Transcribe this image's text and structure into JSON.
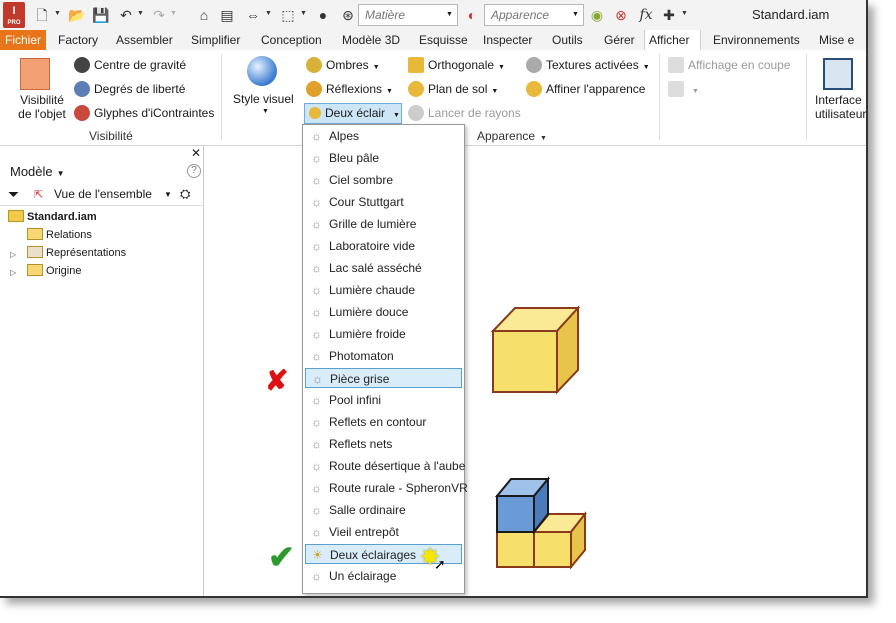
{
  "window": {
    "title": "Standard.iam"
  },
  "qat": {
    "logo_text": "I",
    "logo_sub": "PRO",
    "material_combo": "Matière",
    "appearance_combo": "Apparence",
    "fx_label": "fx"
  },
  "tabs": [
    {
      "label": "Fichier"
    },
    {
      "label": "Factory"
    },
    {
      "label": "Assembler"
    },
    {
      "label": "Simplifier"
    },
    {
      "label": "Conception"
    },
    {
      "label": "Modèle 3D"
    },
    {
      "label": "Esquisse"
    },
    {
      "label": "Inspecter"
    },
    {
      "label": "Outils"
    },
    {
      "label": "Gérer"
    },
    {
      "label": "Afficher"
    },
    {
      "label": "Environnements"
    },
    {
      "label": "Mise e"
    }
  ],
  "ribbon": {
    "visibilite_objet": "Visibilité de l'objet",
    "centre_gravite": "Centre de gravité",
    "degres_liberte": "Degrés de liberté",
    "glyphes": "Glyphes d'iContraintes",
    "panel_visibilite": "Visibilité",
    "style_visuel": "Style visuel",
    "ombres": "Ombres",
    "reflexions": "Réflexions",
    "deux_eclair": "Deux éclair",
    "orthogonale": "Orthogonale",
    "plan_de_sol": "Plan de sol",
    "lancer_rayons": "Lancer de rayons",
    "textures_activees": "Textures activées",
    "affiner_apparence": "Affiner l'apparence",
    "affichage_coupe": "Affichage en coupe",
    "panel_apparence": "Apparence",
    "interface": "Interface",
    "utilisateur": "utilisateur"
  },
  "browser": {
    "title": "Modèle",
    "view_label": "Vue de l'ensemble",
    "tree": [
      {
        "label": "Standard.iam"
      },
      {
        "label": "Relations"
      },
      {
        "label": "Représentations"
      },
      {
        "label": "Origine"
      }
    ]
  },
  "lighting_menu": {
    "items": [
      "Alpes",
      "Bleu pâle",
      "Ciel sombre",
      "Cour Stuttgart",
      "Grille de lumière",
      "Laboratoire vide",
      "Lac salé asséché",
      "Lumière chaude",
      "Lumière douce",
      "Lumière froide",
      "Photomaton",
      "Pièce grise",
      "Pool infini",
      "Reflets en contour",
      "Reflets nets",
      "Route désertique à l'aube",
      "Route rurale - SpheronVR",
      "Salle ordinaire",
      "Vieil entrepôt",
      "Deux éclairages",
      "Un éclairage"
    ],
    "highlighted": [
      "Pièce grise",
      "Deux éclairages"
    ]
  },
  "colors": {
    "file_tab": "#e8751a",
    "highlight": "#d9ecfa",
    "cube_yellow": "#f6df6a",
    "cube_blue": "#6a9bd6"
  }
}
